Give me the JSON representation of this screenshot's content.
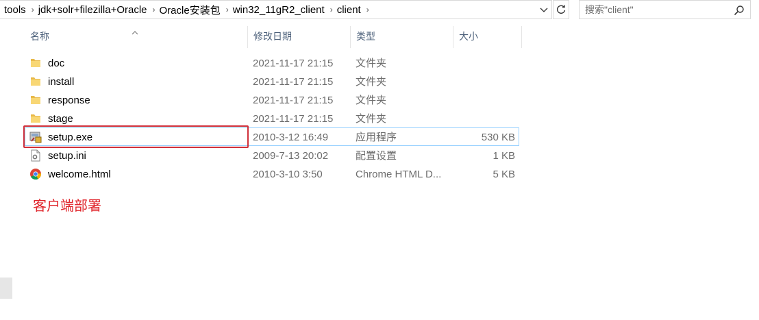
{
  "breadcrumb": [
    "tools",
    "jdk+solr+filezilla+Oracle",
    "Oracle安装包",
    "win32_11gR2_client",
    "client"
  ],
  "search": {
    "placeholder": "搜索\"client\""
  },
  "icons": {
    "dropdown": "chevron-down-icon",
    "refresh": "refresh-icon",
    "search": "search-icon",
    "folder": "folder-icon",
    "exe": "installer-exe-icon",
    "ini": "settings-file-icon",
    "html": "chrome-html-icon"
  },
  "columns": {
    "name": "名称",
    "date": "修改日期",
    "type": "类型",
    "size": "大小"
  },
  "files": [
    {
      "name": "doc",
      "date": "2021-11-17 21:15",
      "type": "文件夹",
      "size": "",
      "icon": "folder-icon"
    },
    {
      "name": "install",
      "date": "2021-11-17 21:15",
      "type": "文件夹",
      "size": "",
      "icon": "folder-icon"
    },
    {
      "name": "response",
      "date": "2021-11-17 21:15",
      "type": "文件夹",
      "size": "",
      "icon": "folder-icon"
    },
    {
      "name": "stage",
      "date": "2021-11-17 21:15",
      "type": "文件夹",
      "size": "",
      "icon": "folder-icon"
    },
    {
      "name": "setup.exe",
      "date": "2010-3-12 16:49",
      "type": "应用程序",
      "size": "530 KB",
      "icon": "installer-exe-icon",
      "selected": true
    },
    {
      "name": "setup.ini",
      "date": "2009-7-13 20:02",
      "type": "配置设置",
      "size": "1 KB",
      "icon": "settings-file-icon"
    },
    {
      "name": "welcome.html",
      "date": "2010-3-10 3:50",
      "type": "Chrome HTML D...",
      "size": "5 KB",
      "icon": "chrome-html-icon"
    }
  ],
  "annotation": "客户端部署",
  "colors": {
    "annotation": "#e0262c",
    "highlight_box": "#d0303a",
    "selection_border": "#99d1ff",
    "header_text": "#4c607a"
  }
}
